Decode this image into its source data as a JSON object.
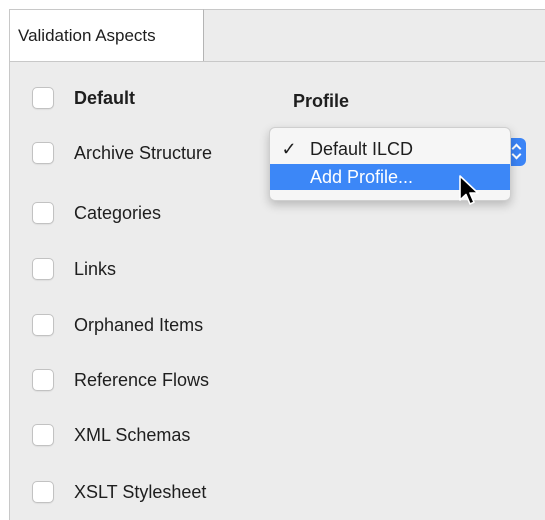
{
  "tabs": [
    {
      "label": "Validation Aspects",
      "active": true
    }
  ],
  "columns": {
    "default_label": "Default",
    "profile_label": "Profile"
  },
  "aspects": [
    {
      "label": "Archive Structure",
      "checked": false
    },
    {
      "label": "Categories",
      "checked": false
    },
    {
      "label": "Links",
      "checked": false
    },
    {
      "label": "Orphaned Items",
      "checked": false
    },
    {
      "label": "Reference Flows",
      "checked": false
    },
    {
      "label": "XML Schemas",
      "checked": false
    },
    {
      "label": "XSLT Stylesheet",
      "checked": false
    }
  ],
  "profile_menu": {
    "items": [
      {
        "label": "Default ILCD",
        "checkmark": "✓",
        "selected": false
      },
      {
        "label": "Add Profile...",
        "checkmark": "",
        "selected": true
      }
    ]
  },
  "colors": {
    "accent": "#3c87f7",
    "panel_bg": "#ececec"
  },
  "icons": {
    "cursor": "arrow-cursor-icon",
    "popup_arrows": "up-down-chevron-icon"
  }
}
